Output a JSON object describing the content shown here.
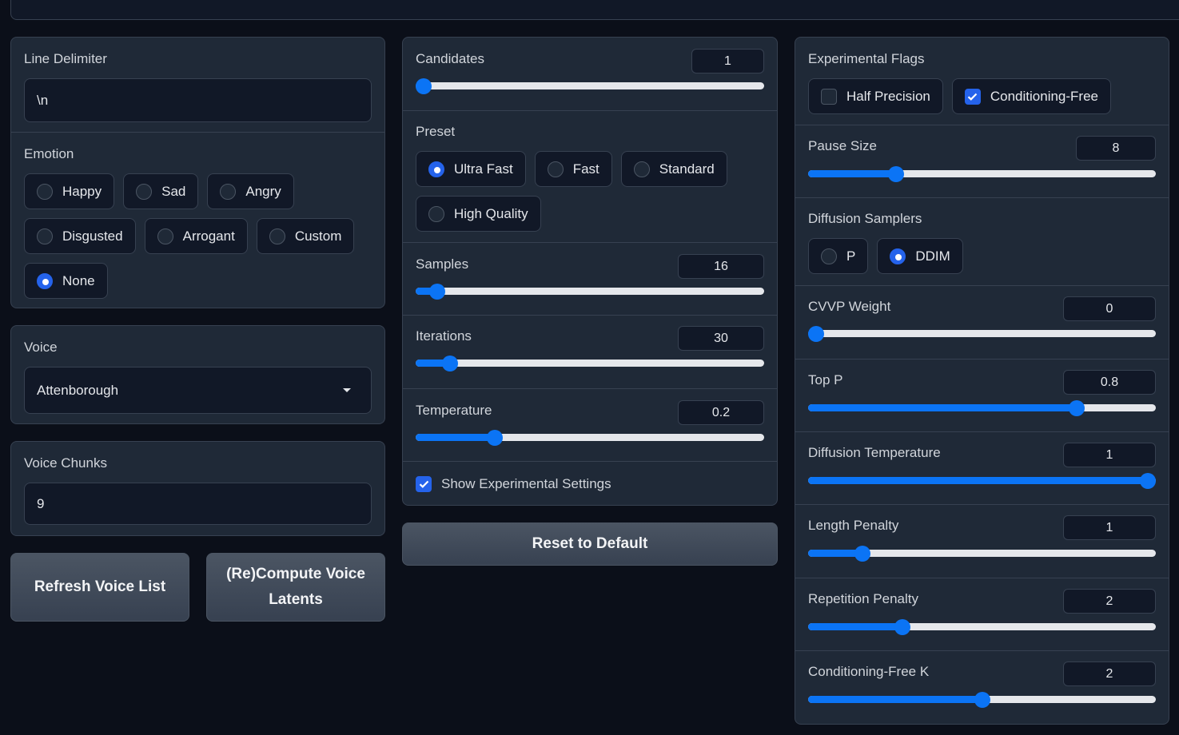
{
  "left": {
    "line_delimiter": {
      "label": "Line Delimiter",
      "value": "\\n"
    },
    "emotion": {
      "label": "Emotion",
      "options": [
        "Happy",
        "Sad",
        "Angry",
        "Disgusted",
        "Arrogant",
        "Custom",
        "None"
      ],
      "selected": "None"
    },
    "voice": {
      "label": "Voice",
      "value": "Attenborough"
    },
    "voice_chunks": {
      "label": "Voice Chunks",
      "value": "9"
    },
    "buttons": {
      "refresh": "Refresh Voice List",
      "recompute_line1": "(Re)Compute Voice",
      "recompute_line2": "Latents"
    }
  },
  "middle": {
    "candidates": {
      "label": "Candidates",
      "value": "1",
      "fraction": 0.0
    },
    "preset": {
      "label": "Preset",
      "options": [
        "Ultra Fast",
        "Fast",
        "Standard",
        "High Quality"
      ],
      "selected": "Ultra Fast"
    },
    "samples": {
      "label": "Samples",
      "value": "16",
      "fraction": 0.04
    },
    "iterations": {
      "label": "Iterations",
      "value": "30",
      "fraction": 0.08
    },
    "temperature": {
      "label": "Temperature",
      "value": "0.2",
      "fraction": 0.215
    },
    "show_experimental": {
      "label": "Show Experimental Settings",
      "checked": true
    },
    "reset_button": "Reset to Default"
  },
  "right": {
    "experimental_flags": {
      "label": "Experimental Flags",
      "half_precision": {
        "label": "Half Precision",
        "checked": false
      },
      "conditioning_free": {
        "label": "Conditioning-Free",
        "checked": true
      }
    },
    "pause_size": {
      "label": "Pause Size",
      "value": "8",
      "fraction": 0.24
    },
    "diffusion_samplers": {
      "label": "Diffusion Samplers",
      "options": [
        "P",
        "DDIM"
      ],
      "selected": "DDIM"
    },
    "cvvp_weight": {
      "label": "CVVP Weight",
      "value": "0",
      "fraction": 0.0
    },
    "top_p": {
      "label": "Top P",
      "value": "0.8",
      "fraction": 0.785
    },
    "diffusion_temperature": {
      "label": "Diffusion Temperature",
      "value": "1",
      "fraction": 1.0
    },
    "length_penalty": {
      "label": "Length Penalty",
      "value": "1",
      "fraction": 0.14
    },
    "repetition_penalty": {
      "label": "Repetition Penalty",
      "value": "2",
      "fraction": 0.26
    },
    "conditioning_free_k": {
      "label": "Conditioning-Free K",
      "value": "2",
      "fraction": 0.5
    }
  },
  "colors": {
    "accent": "#0b74f5",
    "checkbox": "#2563eb",
    "background": "#0b0f19",
    "panel": "#1f2937"
  }
}
